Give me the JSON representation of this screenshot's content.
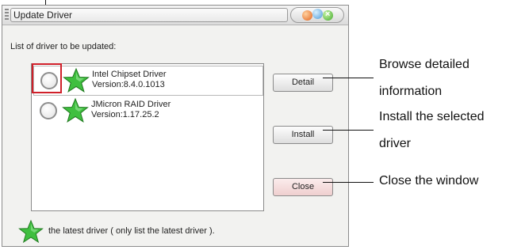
{
  "window": {
    "title": "Update Driver",
    "close_glyph": "×"
  },
  "list": {
    "caption": "List of driver to be updated:",
    "items": [
      {
        "name": "Intel Chipset Driver",
        "version": "Version:8.4.0.1013",
        "icon": "green-star-icon",
        "selected": true
      },
      {
        "name": "JMicron RAID Driver",
        "version": "Version:1.17.25.2",
        "icon": "green-star-icon",
        "selected": false
      }
    ]
  },
  "buttons": {
    "detail": "Detail",
    "install": "Install",
    "close": "Close"
  },
  "legend": {
    "text": "the latest driver ( only list the latest driver ).",
    "icon": "green-star-icon"
  },
  "annotations": {
    "detail_line1": "Browse detailed",
    "detail_line2": "information",
    "install_line1": "Install the selected",
    "install_line2": "driver",
    "close": "Close the window"
  },
  "colors": {
    "highlight": "#d0202a",
    "star_fill": "#3fbf3f"
  }
}
